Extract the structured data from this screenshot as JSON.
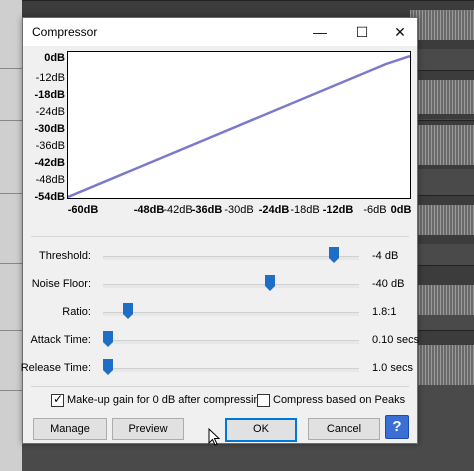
{
  "dialog": {
    "title": "Compressor",
    "controls": {
      "minimize": "—",
      "maximize": "☐",
      "close": "✕"
    }
  },
  "graph": {
    "y_labels": [
      "0dB",
      "-12dB",
      "-18dB",
      "-24dB",
      "-30dB",
      "-36dB",
      "-42dB",
      "-48dB",
      "-54dB"
    ],
    "x_labels": [
      "-60dB",
      "-48dB",
      "-42dB",
      "-36dB",
      "-30dB",
      "-24dB",
      "-18dB",
      "-12dB",
      "-6dB",
      "0dB"
    ],
    "line_color": "#7a7acc"
  },
  "sliders": [
    {
      "label": "Threshold:",
      "value": "-4 dB",
      "position": 0.92
    },
    {
      "label": "Noise Floor:",
      "value": "-40 dB",
      "position": 0.66
    },
    {
      "label": "Ratio:",
      "value": "1.8:1",
      "position": 0.08
    },
    {
      "label": "Attack Time:",
      "value": "0.10 secs",
      "position": 0.0
    },
    {
      "label": "Release Time:",
      "value": "1.0 secs",
      "position": 0.0
    }
  ],
  "options": {
    "makeup_gain": {
      "label": "Make-up gain for 0 dB after compressing",
      "checked": true
    },
    "peaks": {
      "label": "Compress based on Peaks",
      "checked": false
    }
  },
  "buttons": {
    "manage": "Manage",
    "preview": "Preview",
    "ok": "OK",
    "cancel": "Cancel",
    "help": "?"
  },
  "colors": {
    "accent": "#0078d7",
    "thumb": "#1e6ec8",
    "help": "#3b6fd6"
  }
}
